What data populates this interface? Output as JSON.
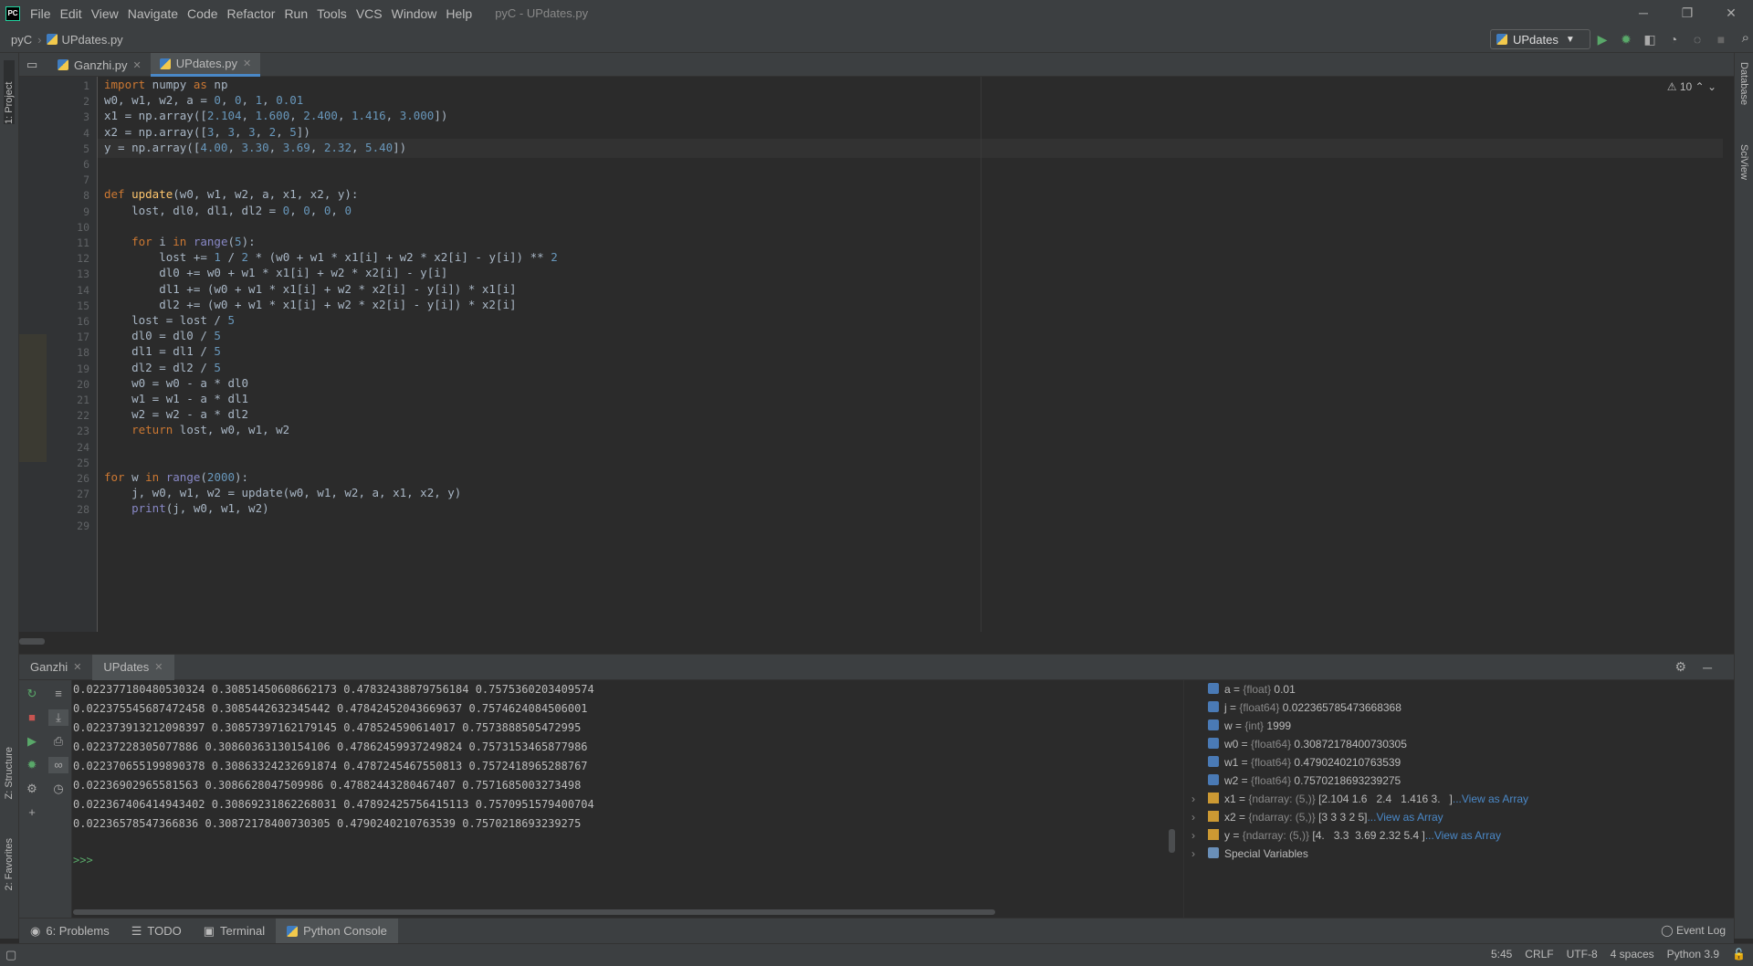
{
  "app": {
    "title": "pyC - UPdates.py",
    "project": "pyC",
    "file": "UPdates.py"
  },
  "menu": [
    "File",
    "Edit",
    "View",
    "Navigate",
    "Code",
    "Refactor",
    "Run",
    "Tools",
    "VCS",
    "Window",
    "Help"
  ],
  "run_config": "UPdates",
  "editor_tabs": [
    {
      "label": "Ganzhi.py"
    },
    {
      "label": "UPdates.py"
    }
  ],
  "inspection": "⚠ 10",
  "left_stripe": {
    "project": "1: Project",
    "structure": "Z: Structure",
    "favorites": "2: Favorites"
  },
  "right_stripe": {
    "database": "Database",
    "sciview": "SciView"
  },
  "code_lines": [
    "import numpy as np",
    "w0, w1, w2, a = 0, 0, 1, 0.01",
    "x1 = np.array([2.104, 1.600, 2.400, 1.416, 3.000])",
    "x2 = np.array([3, 3, 3, 2, 5])",
    "y = np.array([4.00, 3.30, 3.69, 2.32, 5.40])",
    "",
    "",
    "def update(w0, w1, w2, a, x1, x2, y):",
    "    lost, dl0, dl1, dl2 = 0, 0, 0, 0",
    "",
    "    for i in range(5):",
    "        lost += 1 / 2 * (w0 + w1 * x1[i] + w2 * x2[i] - y[i]) ** 2",
    "        dl0 += w0 + w1 * x1[i] + w2 * x2[i] - y[i]",
    "        dl1 += (w0 + w1 * x1[i] + w2 * x2[i] - y[i]) * x1[i]",
    "        dl2 += (w0 + w1 * x1[i] + w2 * x2[i] - y[i]) * x2[i]",
    "    lost = lost / 5",
    "    dl0 = dl0 / 5",
    "    dl1 = dl1 / 5",
    "    dl2 = dl2 / 5",
    "    w0 = w0 - a * dl0",
    "    w1 = w1 - a * dl1",
    "    w2 = w2 - a * dl2",
    "    return lost, w0, w1, w2",
    "",
    "",
    "for w in range(2000):",
    "    j, w0, w1, w2 = update(w0, w1, w2, a, x1, x2, y)",
    "    print(j, w0, w1, w2)",
    ""
  ],
  "console_tabs": [
    {
      "label": "Ganzhi"
    },
    {
      "label": "UPdates"
    }
  ],
  "console_output": [
    "0.022377180480530324 0.30851450608662173 0.47832438879756184 0.7575360203409574",
    "0.022375545687472458 0.3085442632345442 0.47842452043669637 0.7574624084506001",
    "0.022373913212098397 0.30857397162179145 0.478524590614017 0.7573888505472995",
    "0.02237228305077886 0.30860363130154106 0.47862459937249824 0.7573153465877986",
    "0.022370655199890378 0.30863324232691874 0.4787245467550813 0.7572418965288767",
    "0.02236902965581563 0.3086628047509986 0.47882443280467407 0.7571685003273498",
    "0.022367406414943402 0.30869231862268031 0.47892425756415113 0.7570951579400704",
    "0.02236578547366836 0.30872178400730305 0.4790240210763539 0.7570218693239275"
  ],
  "prompt": ">>>",
  "variables": [
    {
      "name": "a",
      "type": "{float}",
      "value": "0.01"
    },
    {
      "name": "j",
      "type": "{float64}",
      "value": "0.022365785473668368"
    },
    {
      "name": "w",
      "type": "{int}",
      "value": "1999"
    },
    {
      "name": "w0",
      "type": "{float64}",
      "value": "0.30872178400730305"
    },
    {
      "name": "w1",
      "type": "{float64}",
      "value": "0.4790240210763539"
    },
    {
      "name": "w2",
      "type": "{float64}",
      "value": "0.7570218693239275"
    },
    {
      "name": "x1",
      "type": "{ndarray: (5,)}",
      "value": "[2.104 1.6   2.4   1.416 3.   ]",
      "link": "...View as Array"
    },
    {
      "name": "x2",
      "type": "{ndarray: (5,)}",
      "value": "[3 3 3 2 5]",
      "link": "...View as Array"
    },
    {
      "name": "y",
      "type": "{ndarray: (5,)}",
      "value": "[4.   3.3  3.69 2.32 5.4 ]",
      "link": "...View as Array"
    }
  ],
  "special_vars": "Special Variables",
  "bottom_tabs": [
    {
      "label": "6: Problems"
    },
    {
      "label": "TODO"
    },
    {
      "label": "Terminal"
    },
    {
      "label": "Python Console"
    }
  ],
  "event_log": "Event Log",
  "status": {
    "position": "5:45",
    "line_sep": "CRLF",
    "encoding": "UTF-8",
    "indent": "4 spaces",
    "interpreter": "Python 3.9"
  }
}
